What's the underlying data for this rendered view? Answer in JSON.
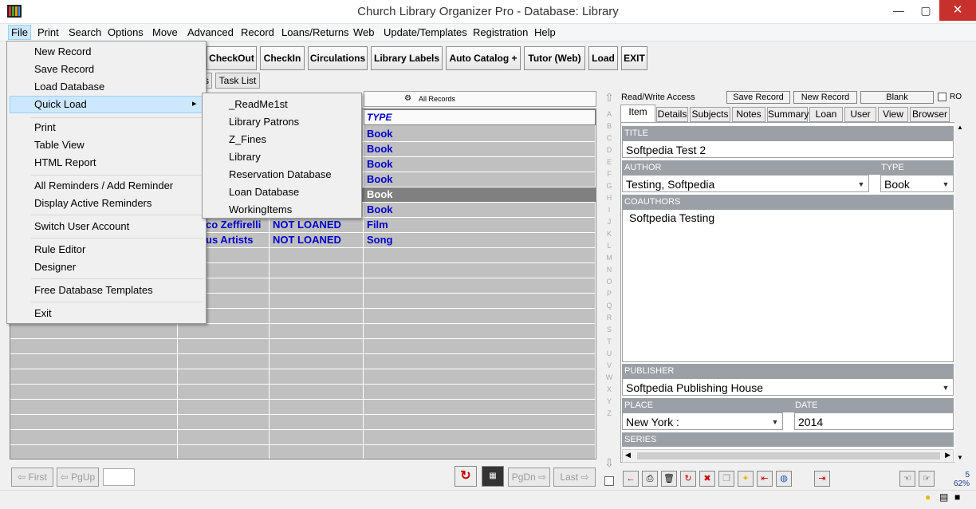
{
  "window": {
    "title": "Church Library Organizer Pro - Database: Library"
  },
  "menubar": [
    "File",
    "Print",
    "Search",
    "Options",
    "Move",
    "Advanced",
    "Record",
    "Loans/Returns",
    "Web",
    "Update/Templates",
    "Registration",
    "Help"
  ],
  "toolbar": [
    "CheckOut",
    "CheckIn",
    "Circulations",
    "Library Labels",
    "Auto Catalog +",
    "Tutor (Web)",
    "Load",
    "EXIT"
  ],
  "subtabs": {
    "hidden_tab": "s",
    "task_list": "Task List"
  },
  "filter": {
    "label": "All Records"
  },
  "grid": {
    "type_header": "TYPE",
    "rows": [
      {
        "author": "",
        "status": "",
        "type": "Book"
      },
      {
        "author": "",
        "status": "",
        "type": "Book"
      },
      {
        "author": "",
        "status": "",
        "type": "Book"
      },
      {
        "author": "",
        "status": "",
        "type": "Book"
      },
      {
        "author": "",
        "status": "",
        "type": "Book"
      },
      {
        "author": "",
        "status": "",
        "type": "Book"
      },
      {
        "author": "co Zeffirelli",
        "status": "NOT LOANED",
        "type": "Film"
      },
      {
        "author": "us Artists",
        "status": "NOT LOANED",
        "type": "Song"
      }
    ]
  },
  "file_menu": {
    "items": [
      "New Record",
      "Save Record",
      "Load Database",
      "Quick Load",
      "Print",
      "Table View",
      "HTML Report",
      "All Reminders / Add Reminder",
      "Display Active Reminders",
      "Switch User Account",
      "Rule Editor",
      "Designer",
      "Free Database Templates",
      "Exit"
    ],
    "submenu_arrow": "▸"
  },
  "quick_load": [
    "_ReadMe1st",
    "Library Patrons",
    "Z_Fines",
    "Library",
    "Reservation Database",
    "Loan Database",
    "WorkingItems"
  ],
  "alphabet": [
    "A",
    "B",
    "C",
    "D",
    "E",
    "F",
    "G",
    "H",
    "I",
    "J",
    "K",
    "L",
    "M",
    "N",
    "O",
    "P",
    "Q",
    "R",
    "S",
    "T",
    "U",
    "V",
    "W",
    "X",
    "Y",
    "Z"
  ],
  "nav": {
    "first": "First",
    "pgup": "PgUp",
    "pgdn": "PgDn",
    "last": "Last"
  },
  "record_panel": {
    "access": "Read/Write Access",
    "save": "Save Record",
    "new": "New Record",
    "blank": "Blank",
    "ro": "RO",
    "tabs": [
      "Item",
      "Details",
      "Subjects",
      "Notes",
      "Summary",
      "Loan",
      "User",
      "View",
      "Browser"
    ],
    "title_label": "TITLE",
    "title": "Softpedia Test 2",
    "author_label": "AUTHOR",
    "author": "Testing, Softpedia",
    "type_label": "TYPE",
    "type": "Book",
    "coauthors_label": "COAUTHORS",
    "coauthors": "Softpedia Testing",
    "publisher_label": "PUBLISHER",
    "publisher": "Softpedia Publishing House",
    "place_label": "PLACE",
    "place": "New York :",
    "date_label": "DATE",
    "date": "2014",
    "series_label": "SERIES"
  },
  "status": {
    "count": "5",
    "percent": "62%"
  },
  "colors": {
    "close": "#c7302b",
    "menu_highlight": "#cce8ff",
    "link_blue": "#0000cc",
    "grid_bg": "#c0c0c0"
  }
}
